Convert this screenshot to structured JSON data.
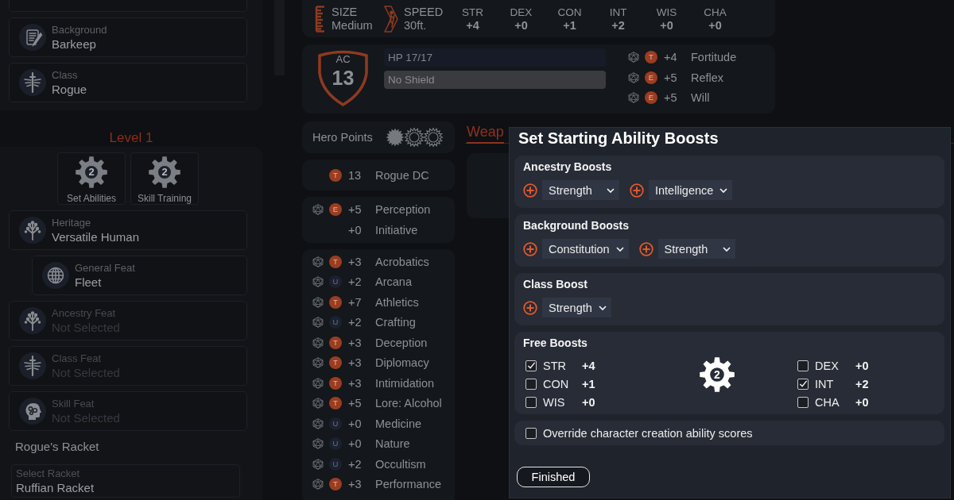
{
  "sidebar": {
    "top_cards": [
      {
        "kind": "background",
        "label": "Background",
        "value": "Barkeep",
        "chosen": true
      },
      {
        "kind": "class",
        "label": "Class",
        "value": "Rogue",
        "chosen": true
      }
    ],
    "level": {
      "title": "Level 1",
      "actions": [
        {
          "label": "Set Abilities",
          "count": "2"
        },
        {
          "label": "Skill Training",
          "count": "2"
        }
      ],
      "cards": [
        {
          "kind": "ancestry",
          "label": "Heritage",
          "value": "Versatile Human",
          "chosen": true,
          "children": [
            {
              "kind": "general",
              "label": "General Feat",
              "value": "Fleet",
              "chosen": true
            }
          ]
        },
        {
          "kind": "ancestry",
          "label": "Ancestry Feat",
          "value": "Not Selected",
          "chosen": false
        },
        {
          "kind": "class",
          "label": "Class Feat",
          "value": "Not Selected",
          "chosen": false
        },
        {
          "kind": "skill",
          "label": "Skill Feat",
          "value": "Not Selected",
          "chosen": false
        }
      ],
      "racket": {
        "title": "Rogue's Racket",
        "field_label": "Select Racket",
        "value": "Ruffian Racket"
      }
    }
  },
  "stats": {
    "size": {
      "label": "SIZE",
      "value": "Medium"
    },
    "speed": {
      "label": "SPEED",
      "value": "30ft."
    },
    "abilities": [
      {
        "label": "STR",
        "value": "+4"
      },
      {
        "label": "DEX",
        "value": "+0"
      },
      {
        "label": "CON",
        "value": "+1"
      },
      {
        "label": "INT",
        "value": "+2"
      },
      {
        "label": "WIS",
        "value": "+0"
      },
      {
        "label": "CHA",
        "value": "+0"
      }
    ]
  },
  "defense": {
    "ac": {
      "label": "AC",
      "value": "13"
    },
    "hp": "HP 17/17",
    "shield": "No Shield",
    "saves": [
      {
        "rank": "T",
        "color": "#9a3d20",
        "value": "+4",
        "name": "Fortitude"
      },
      {
        "rank": "E",
        "color": "#9a3d20",
        "value": "+5",
        "name": "Reflex"
      },
      {
        "rank": "E",
        "color": "#9a3d20",
        "value": "+5",
        "name": "Will"
      }
    ]
  },
  "hero_points": {
    "label": "Hero Points",
    "points": [
      {
        "on": true
      },
      {
        "on": false
      },
      {
        "on": false
      }
    ]
  },
  "class_dc": {
    "rank": "T",
    "color": "#9a3d20",
    "value": "13",
    "name": "Rogue DC"
  },
  "perception": [
    {
      "rollable": true,
      "rank": "E",
      "color": "#9a3d20",
      "value": "+5",
      "name": "Perception"
    },
    {
      "rollable": false,
      "value": "+0",
      "name": "Initiative"
    }
  ],
  "skills": [
    {
      "rank": "T",
      "color": "#9a3d20",
      "value": "+3",
      "name": "Acrobatics"
    },
    {
      "rank": "U",
      "color": "#1c2130",
      "value": "+2",
      "name": "Arcana"
    },
    {
      "rank": "T",
      "color": "#9a3d20",
      "value": "+7",
      "name": "Athletics"
    },
    {
      "rank": "U",
      "color": "#1c2130",
      "value": "+2",
      "name": "Crafting"
    },
    {
      "rank": "T",
      "color": "#9a3d20",
      "value": "+3",
      "name": "Deception"
    },
    {
      "rank": "T",
      "color": "#9a3d20",
      "value": "+3",
      "name": "Diplomacy"
    },
    {
      "rank": "T",
      "color": "#9a3d20",
      "value": "+3",
      "name": "Intimidation"
    },
    {
      "rank": "T",
      "color": "#9a3d20",
      "value": "+5",
      "name": "Lore: Alcohol"
    },
    {
      "rank": "U",
      "color": "#1c2130",
      "value": "+0",
      "name": "Medicine"
    },
    {
      "rank": "U",
      "color": "#1c2130",
      "value": "+0",
      "name": "Nature"
    },
    {
      "rank": "U",
      "color": "#1c2130",
      "value": "+2",
      "name": "Occultism"
    },
    {
      "rank": "T",
      "color": "#9a3d20",
      "value": "+3",
      "name": "Performance"
    }
  ],
  "tabs": [
    {
      "label": "Weap",
      "selected": true
    }
  ],
  "dialog": {
    "title": "Set Starting Ability Boosts",
    "sections": [
      {
        "title": "Ancestry Boosts",
        "boosts": [
          "Strength",
          "Intelligence"
        ]
      },
      {
        "title": "Background Boosts",
        "boosts": [
          "Constitution",
          "Strength"
        ]
      },
      {
        "title": "Class Boost",
        "boosts": [
          "Strength"
        ]
      }
    ],
    "free_boosts": {
      "title": "Free Boosts",
      "remaining": "2",
      "columns": [
        {
          "options": [
            {
              "label": "STR",
              "value": "+4",
              "checked": true
            },
            {
              "label": "CON",
              "value": "+1",
              "checked": false
            },
            {
              "label": "WIS",
              "value": "+0",
              "checked": false
            }
          ]
        },
        {
          "options": [
            {
              "label": "DEX",
              "value": "+0",
              "checked": false
            },
            {
              "label": "INT",
              "value": "+2",
              "checked": true
            },
            {
              "label": "CHA",
              "value": "+0",
              "checked": false
            }
          ]
        }
      ]
    },
    "override": {
      "label": "Override character creation ability scores",
      "checked": false
    },
    "button": "Finished"
  }
}
